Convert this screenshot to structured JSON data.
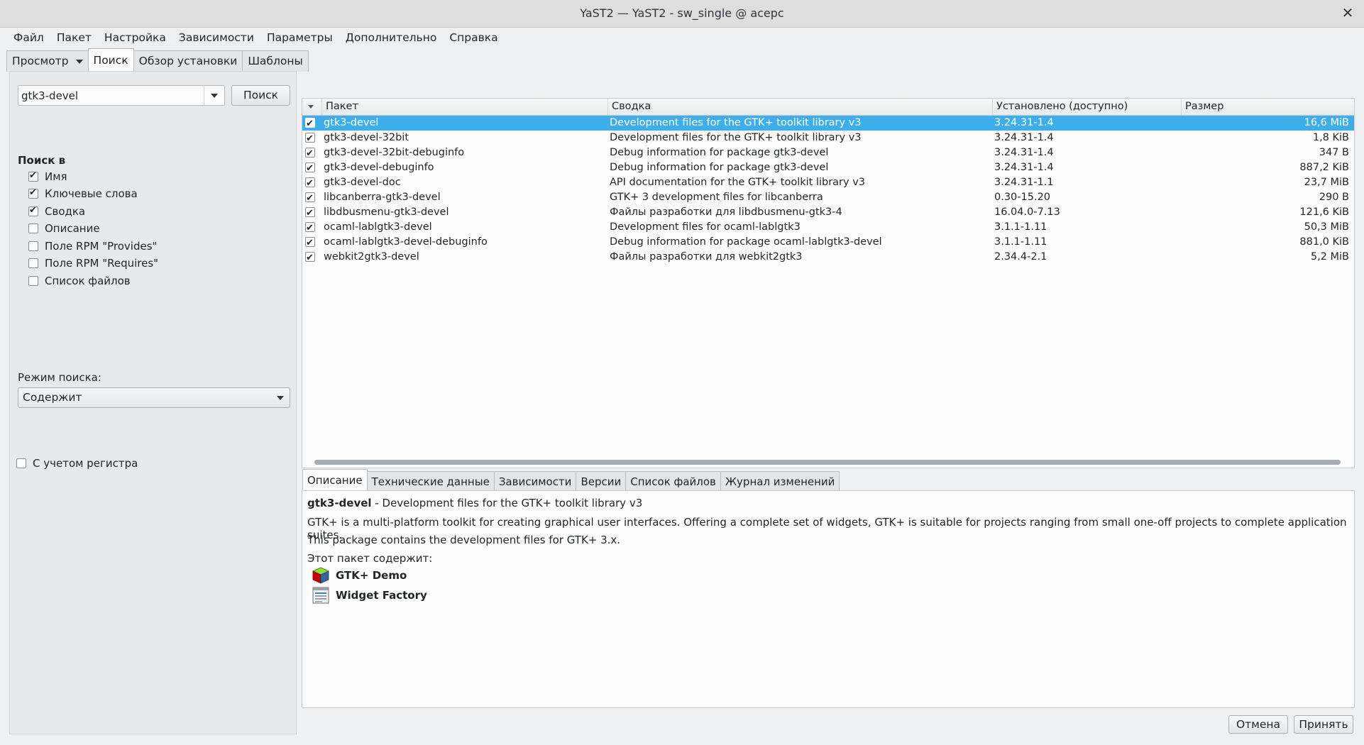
{
  "window": {
    "title": "YaST2 — YaST2 - sw_single @ acepc",
    "close_symbol": "✕"
  },
  "menu": [
    "Файл",
    "Пакет",
    "Настройка",
    "Зависимости",
    "Параметры",
    "Дополнительно",
    "Справка"
  ],
  "top_tabs": [
    "Просмотр",
    "Поиск",
    "Обзор установки",
    "Шаблоны"
  ],
  "search": {
    "value": "gtk3-devel",
    "button": "Поиск",
    "search_in_title": "Поиск в",
    "options": [
      {
        "label": "Имя",
        "checked": true
      },
      {
        "label": "Ключевые слова",
        "checked": true
      },
      {
        "label": "Сводка",
        "checked": true
      },
      {
        "label": "Описание",
        "checked": false
      },
      {
        "label": "Поле RPM \"Provides\"",
        "checked": false
      },
      {
        "label": "Поле RPM \"Requires\"",
        "checked": false
      },
      {
        "label": "Список файлов",
        "checked": false
      }
    ],
    "mode_label": "Режим поиска:",
    "mode_value": "Содержит",
    "case_label": "С учетом регистра",
    "case_checked": false
  },
  "table": {
    "columns": [
      "Пакет",
      "Сводка",
      "Установлено (доступно)",
      "Размер"
    ],
    "rows": [
      {
        "name": "gtk3-devel",
        "summary": "Development files for the GTK+ toolkit library v3",
        "installed": "3.24.31-1.4",
        "size": "16,6 MiB",
        "checked": true,
        "selected": true
      },
      {
        "name": "gtk3-devel-32bit",
        "summary": "Development files for the GTK+ toolkit library v3",
        "installed": "3.24.31-1.4",
        "size": "1,8 KiB",
        "checked": true,
        "selected": false
      },
      {
        "name": "gtk3-devel-32bit-debuginfo",
        "summary": "Debug information for package gtk3-devel",
        "installed": "3.24.31-1.4",
        "size": "347 B",
        "checked": true,
        "selected": false
      },
      {
        "name": "gtk3-devel-debuginfo",
        "summary": "Debug information for package gtk3-devel",
        "installed": "3.24.31-1.4",
        "size": "887,2 KiB",
        "checked": true,
        "selected": false
      },
      {
        "name": "gtk3-devel-doc",
        "summary": "API documentation for the GTK+ toolkit library v3",
        "installed": "3.24.31-1.1",
        "size": "23,7 MiB",
        "checked": true,
        "selected": false
      },
      {
        "name": "libcanberra-gtk3-devel",
        "summary": "GTK+ 3 development files for libcanberra",
        "installed": "0.30-15.20",
        "size": "290 B",
        "checked": true,
        "selected": false
      },
      {
        "name": "libdbusmenu-gtk3-devel",
        "summary": "Файлы разработки для libdbusmenu-gtk3-4",
        "installed": "16.04.0-7.13",
        "size": "121,6 KiB",
        "checked": true,
        "selected": false
      },
      {
        "name": "ocaml-lablgtk3-devel",
        "summary": "Development files for ocaml-lablgtk3",
        "installed": "3.1.1-1.11",
        "size": "50,3 MiB",
        "checked": true,
        "selected": false
      },
      {
        "name": "ocaml-lablgtk3-devel-debuginfo",
        "summary": "Debug information for package ocaml-lablgtk3-devel",
        "installed": "3.1.1-1.11",
        "size": "881,0 KiB",
        "checked": true,
        "selected": false
      },
      {
        "name": "webkit2gtk3-devel",
        "summary": "Файлы разработки для webkit2gtk3",
        "installed": "2.34.4-2.1",
        "size": "5,2 MiB",
        "checked": true,
        "selected": false
      }
    ]
  },
  "detail_tabs": [
    "Описание",
    "Технические данные",
    "Зависимости",
    "Версии",
    "Список файлов",
    "Журнал изменений"
  ],
  "description": {
    "pkg_name": "gtk3-devel",
    "pkg_summary": " - Development files for the GTK+ toolkit library v3",
    "paragraph1": "GTK+ is a multi-platform toolkit for creating graphical user interfaces. Offering a complete set of widgets, GTK+ is suitable for projects ranging from small one-off projects to complete application suites.",
    "paragraph2": "This package contains the development files for GTK+ 3.x.",
    "contains_label": "Этот пакет содержит:",
    "apps": [
      "GTK+ Demo",
      "Widget Factory"
    ]
  },
  "buttons": {
    "cancel": "Отмена",
    "accept": "Принять"
  },
  "colors": {
    "selection": "#3daee9",
    "background": "#eff0f1"
  }
}
